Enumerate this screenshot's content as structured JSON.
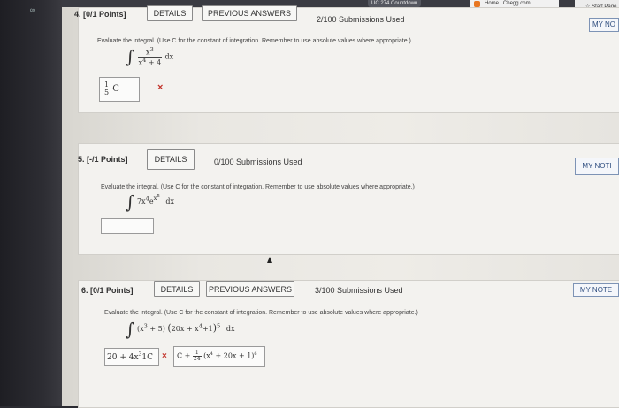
{
  "browser": {
    "countdown_tab": "UC 274 Countdown",
    "chegg_tab": "Home | Chegg.com",
    "start_page": "Start Page",
    "dock_icon": "link-icon"
  },
  "q4": {
    "header": "4. [0/1 Points]",
    "details": "DETAILS",
    "previous": "PREVIOUS ANSWERS",
    "submissions": "2/100 Submissions Used",
    "notes": "MY NO",
    "instruction": "Evaluate the integral. (Use C for the constant of integration. Remember to use absolute values where appropriate.)",
    "answer": "C",
    "answer_frac_num": "1",
    "answer_frac_den": "5",
    "result": "×"
  },
  "q5": {
    "header": "5. [-/1 Points]",
    "details": "DETAILS",
    "submissions": "0/100 Submissions Used",
    "notes": "MY NOTI",
    "instruction": "Evaluate the integral. (Use C for the constant of integration. Remember to use absolute values where appropriate.)",
    "answer": ""
  },
  "q6": {
    "header": "6. [0/1 Points]",
    "details": "DETAILS",
    "previous": "PREVIOUS ANSWERS",
    "submissions": "3/100 Submissions Used",
    "notes": "MY NOTE",
    "instruction": "Evaluate the integral. (Use C for the constant of integration. Remember to use absolute values where appropriate.)",
    "answer": "20 + 4x",
    "answer_exp": "3",
    "answer_tail": "1C",
    "result": "×",
    "correct_prefix": "C +",
    "correct_frac_num": "1",
    "correct_frac_den": "24",
    "correct_tail": "(x",
    "correct_tail2": " + 20x + 1)"
  }
}
